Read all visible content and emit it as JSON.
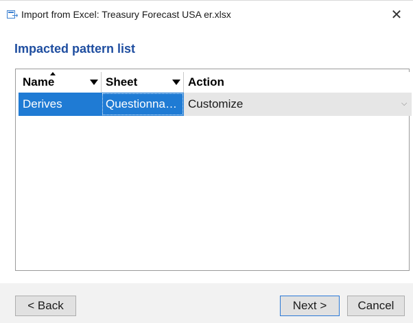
{
  "window": {
    "title": "Import from Excel: Treasury Forecast USA er.xlsx",
    "icon": "import-excel-icon",
    "close_symbol": "✕"
  },
  "heading": "Impacted pattern list",
  "grid": {
    "columns": [
      {
        "label": "Name",
        "sorted": "ascending",
        "filter_icon": "dropdown-arrow-icon"
      },
      {
        "label": "Sheet",
        "filter_icon": "dropdown-arrow-icon"
      },
      {
        "label": "Action"
      }
    ],
    "rows": [
      {
        "name": "Derives",
        "sheet": "Questionna…",
        "action": "Customize",
        "selected": true
      }
    ],
    "combo_arrow": "⌵"
  },
  "footer": {
    "back_label": "< Back",
    "next_label": "Next >",
    "cancel_label": "Cancel"
  },
  "colors": {
    "heading": "#1f4ea0",
    "selection": "#1f7bd4",
    "row_background": "#e6e6e6",
    "default_button_border": "#2a78d6"
  }
}
